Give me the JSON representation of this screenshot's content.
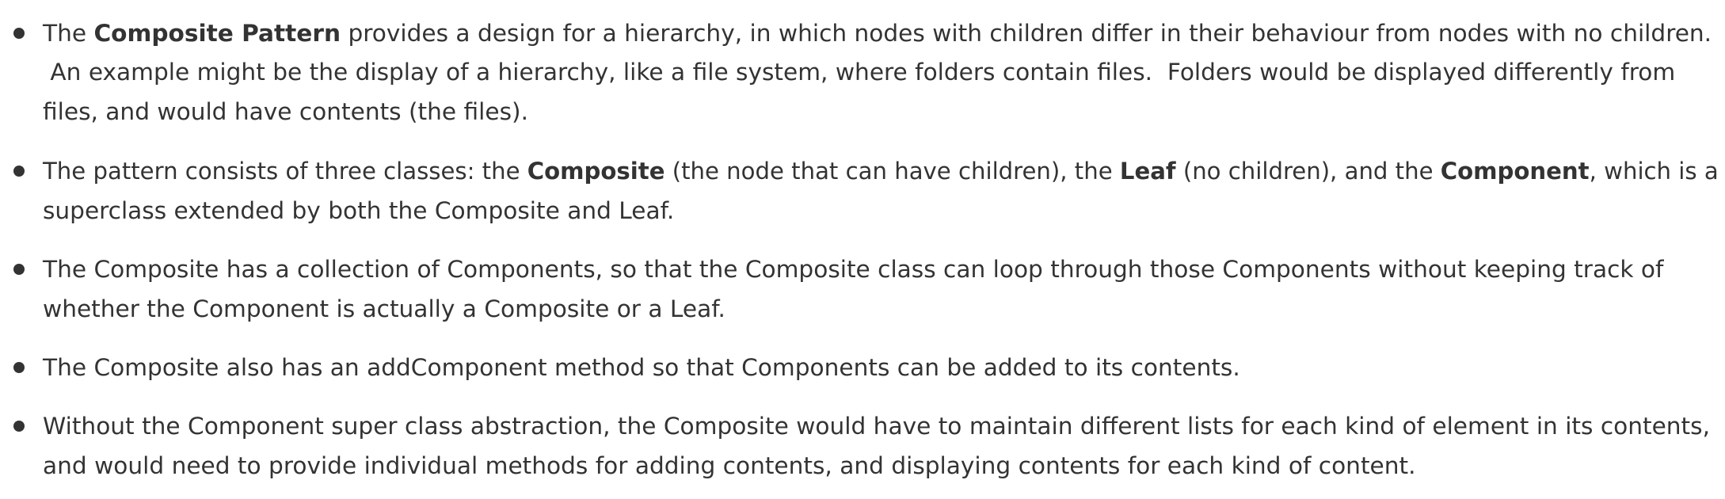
{
  "bullets": [
    {
      "lines": [
        {
          "segments": [
            {
              "text": "The ",
              "bold": false
            },
            {
              "text": "Composite Pattern",
              "bold": true
            },
            {
              "text": " provides a design for a hierarchy, in which nodes with children differ in their behaviour from nodes with no children.",
              "bold": false
            }
          ]
        },
        {
          "segments": [
            {
              "text": " An example might be the display of a hierarchy, like a file system, where folders contain files.  Folders would be displayed differently from",
              "bold": false
            }
          ]
        },
        {
          "segments": [
            {
              "text": "files, and would have contents (the files).",
              "bold": false
            }
          ]
        }
      ]
    },
    {
      "lines": [
        {
          "segments": [
            {
              "text": "The pattern consists of three classes: the ",
              "bold": false
            },
            {
              "text": "Composite",
              "bold": true
            },
            {
              "text": " (the node that can have children), the ",
              "bold": false
            },
            {
              "text": "Leaf",
              "bold": true
            },
            {
              "text": " (no children), and the ",
              "bold": false
            },
            {
              "text": "Component",
              "bold": true
            },
            {
              "text": ", which is a",
              "bold": false
            }
          ]
        },
        {
          "segments": [
            {
              "text": "superclass extended by both the Composite and Leaf.",
              "bold": false
            }
          ]
        }
      ]
    },
    {
      "lines": [
        {
          "segments": [
            {
              "text": "The Composite has a collection of Components, so that the Composite class can loop through those Components without keeping track of",
              "bold": false
            }
          ]
        },
        {
          "segments": [
            {
              "text": "whether the Component is actually a Composite or a Leaf.",
              "bold": false
            }
          ]
        }
      ]
    },
    {
      "lines": [
        {
          "segments": [
            {
              "text": "The Composite also has an addComponent method so that Components can be added to its contents.",
              "bold": false
            }
          ]
        }
      ]
    },
    {
      "lines": [
        {
          "segments": [
            {
              "text": "Without the Component super class abstraction, the Composite would have to maintain different lists for each kind of element in its contents,",
              "bold": false
            }
          ]
        },
        {
          "segments": [
            {
              "text": "and would need to provide individual methods for adding contents, and displaying contents for each kind of content.",
              "bold": false
            }
          ]
        }
      ]
    }
  ]
}
